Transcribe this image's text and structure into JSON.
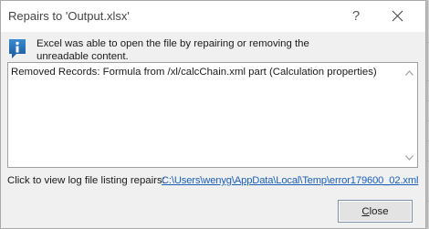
{
  "dialog": {
    "title": "Repairs to 'Output.xlsx'",
    "help_label": "?",
    "message": "Excel was able to open the file by repairing or removing the unreadable content.",
    "repairs": "Removed Records: Formula from /xl/calcChain.xml part (Calculation properties)",
    "log_label": "Click to view log file listing repairs:",
    "log_link": "C:\\Users\\wenyg\\AppData\\Local\\Temp\\error179600_02.xml",
    "close_label_mnemonic": "C",
    "close_label_rest": "lose"
  },
  "icons": {
    "info": "information-icon",
    "close_x": "close-icon",
    "scroll_up": "chevron-up-icon",
    "scroll_down": "chevron-down-icon"
  },
  "colors": {
    "info_icon": "#1f6fb2",
    "link": "#1a5fb4",
    "button_border": "#7a8fa8"
  }
}
